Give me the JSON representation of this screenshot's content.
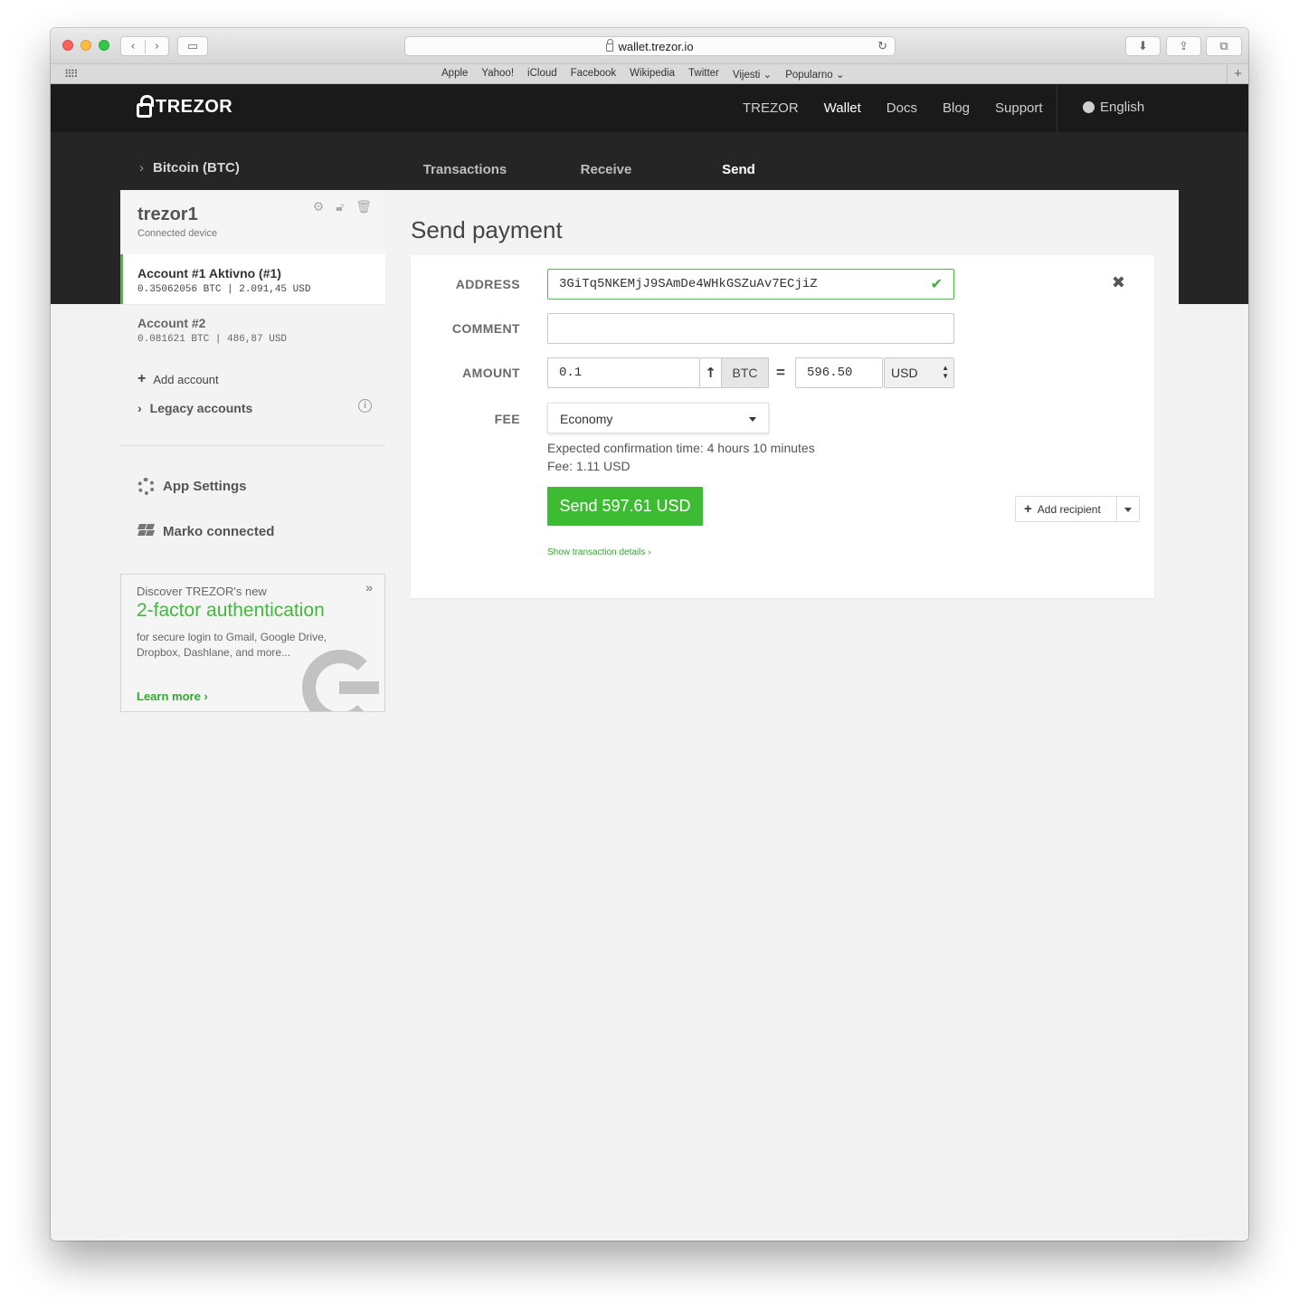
{
  "browser": {
    "url": "wallet.trezor.io",
    "favorites": [
      "Apple",
      "Yahoo!",
      "iCloud",
      "Facebook",
      "Wikipedia",
      "Twitter",
      "Vijesti ⌄",
      "Popularno ⌄"
    ]
  },
  "header": {
    "logo": "TREZOR",
    "nav": [
      "TREZOR",
      "Wallet",
      "Docs",
      "Blog",
      "Support"
    ],
    "active_nav": "Wallet",
    "language": "English"
  },
  "coin": {
    "label": "Bitcoin (BTC)"
  },
  "tabs": [
    {
      "label": "Transactions",
      "active": false
    },
    {
      "label": "Receive",
      "active": false
    },
    {
      "label": "Send",
      "active": true
    }
  ],
  "device": {
    "name": "trezor1",
    "status": "Connected device"
  },
  "accounts": [
    {
      "name": "Account #1 Aktivno (#1)",
      "balance": "0.35062056 BTC | 2.091,45 USD",
      "active": true
    },
    {
      "name": "Account #2",
      "balance": "0.081621 BTC | 486,87 USD",
      "active": false
    }
  ],
  "sidebar": {
    "add_account": "Add account",
    "legacy": "Legacy accounts",
    "app_settings": "App Settings",
    "dropbox": "Marko connected"
  },
  "promo": {
    "pre": "Discover TREZOR's new",
    "title": "2-factor authentication",
    "text": "for secure login to Gmail, Google Drive, Dropbox, Dashlane, and more...",
    "link": "Learn more",
    "close": "»"
  },
  "send": {
    "title": "Send payment",
    "labels": {
      "address": "ADDRESS",
      "comment": "COMMENT",
      "amount": "AMOUNT",
      "fee": "FEE"
    },
    "address": "3GiTq5NKEMjJ9SAmDe4WHkGSZuAv7ECjiZ",
    "comment": "",
    "amount": "0.1",
    "currency": "BTC",
    "equals": "=",
    "fiat_amount": "596.50",
    "fiat_currency": "USD",
    "fee_level": "Economy",
    "confirmation": "Expected confirmation time: 4 hours 10 minutes",
    "fee": "Fee: 1.11 USD",
    "send_button": "Send 597.61 USD",
    "details_link": "Show transaction details ›",
    "add_recipient": "Add recipient"
  },
  "colors": {
    "accent": "#44c03b",
    "dark": "#1a1a1a"
  }
}
